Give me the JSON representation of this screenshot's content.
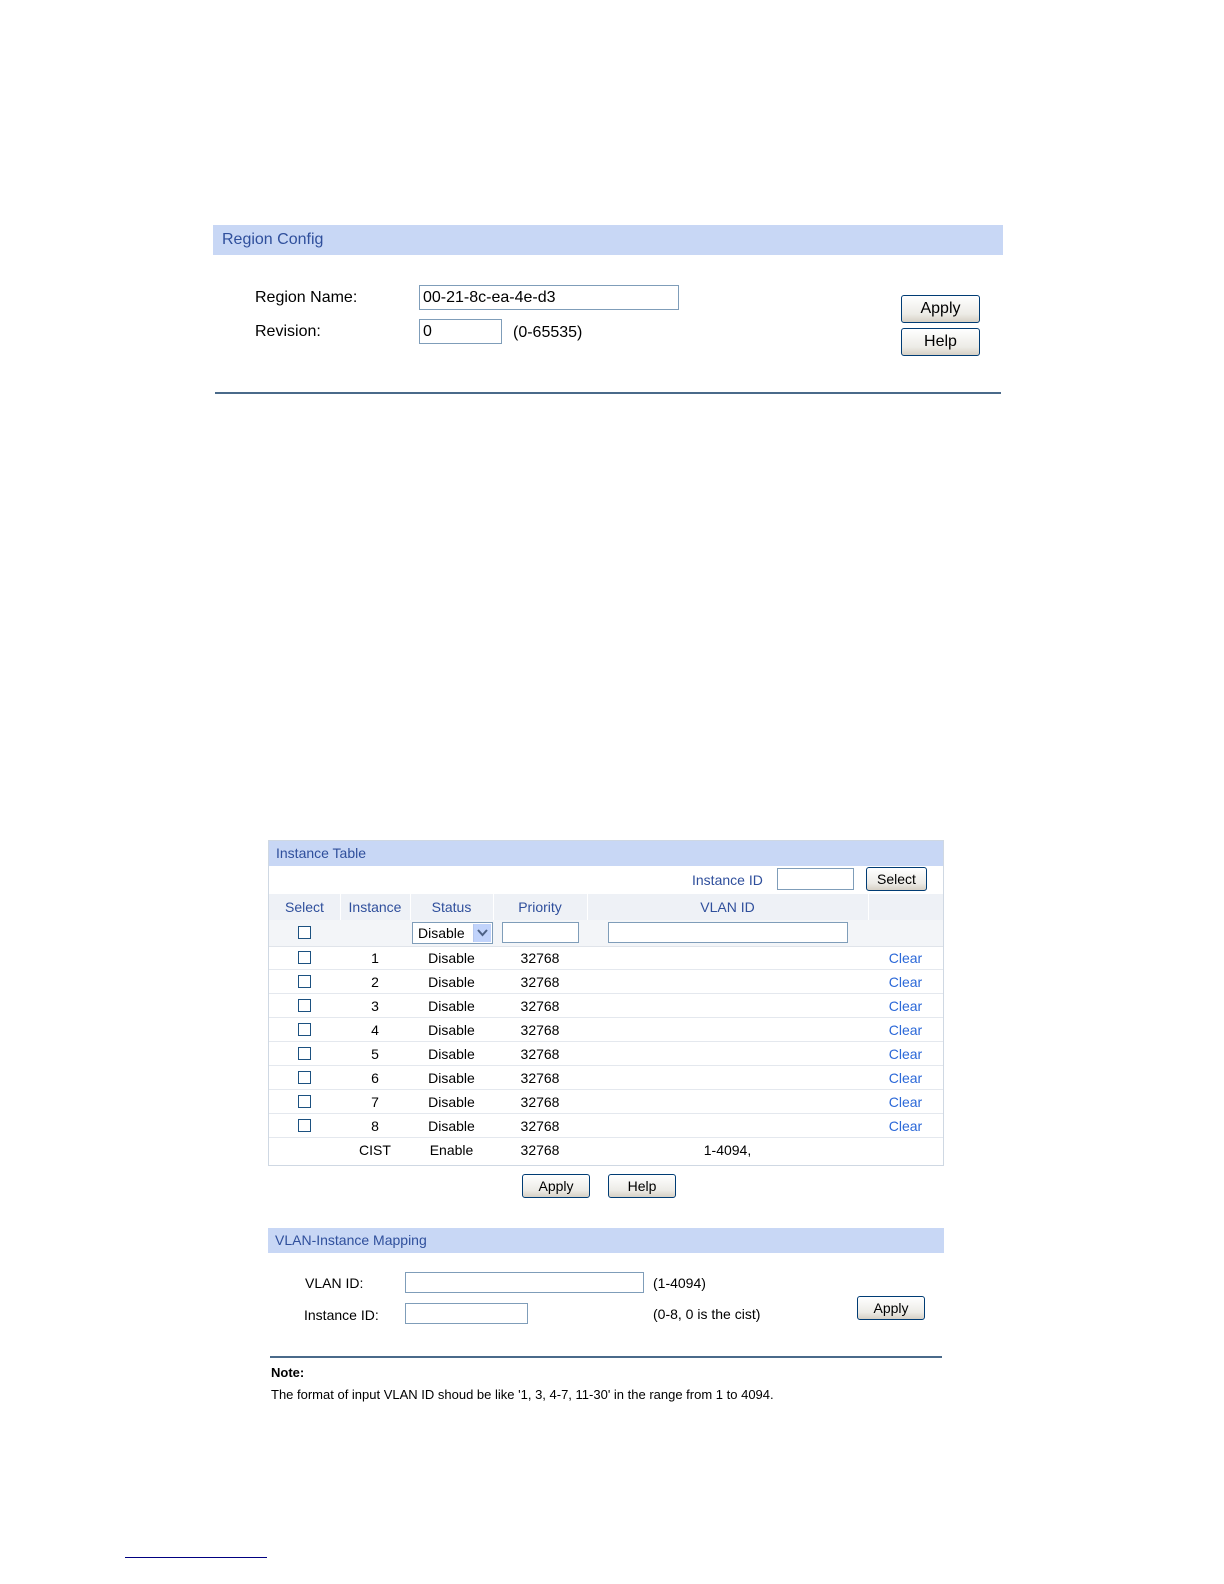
{
  "region_config": {
    "title": "Region Config",
    "region_name_label": "Region Name:",
    "region_name_value": "00-21-8c-ea-4e-d3",
    "revision_label": "Revision:",
    "revision_value": "0",
    "revision_hint": "(0-65535)",
    "apply_label": "Apply",
    "help_label": "Help"
  },
  "instance_table": {
    "title": "Instance Table",
    "instance_id_label": "Instance ID",
    "instance_id_value": "",
    "select_button_label": "Select",
    "columns": [
      "Select",
      "Instance",
      "Status",
      "Priority",
      "VLAN ID"
    ],
    "filter_status_value": "Disable",
    "filter_priority_value": "",
    "filter_vlan_value": "",
    "rows": [
      {
        "instance": "1",
        "status": "Disable",
        "priority": "32768",
        "vlan": "",
        "action": "Clear"
      },
      {
        "instance": "2",
        "status": "Disable",
        "priority": "32768",
        "vlan": "",
        "action": "Clear"
      },
      {
        "instance": "3",
        "status": "Disable",
        "priority": "32768",
        "vlan": "",
        "action": "Clear"
      },
      {
        "instance": "4",
        "status": "Disable",
        "priority": "32768",
        "vlan": "",
        "action": "Clear"
      },
      {
        "instance": "5",
        "status": "Disable",
        "priority": "32768",
        "vlan": "",
        "action": "Clear"
      },
      {
        "instance": "6",
        "status": "Disable",
        "priority": "32768",
        "vlan": "",
        "action": "Clear"
      },
      {
        "instance": "7",
        "status": "Disable",
        "priority": "32768",
        "vlan": "",
        "action": "Clear"
      },
      {
        "instance": "8",
        "status": "Disable",
        "priority": "32768",
        "vlan": "",
        "action": "Clear"
      }
    ],
    "cist_row": {
      "instance": "CIST",
      "status": "Enable",
      "priority": "32768",
      "vlan": "1-4094,"
    },
    "apply_label": "Apply",
    "help_label": "Help"
  },
  "vlan_mapping": {
    "title": "VLAN-Instance Mapping",
    "vlan_id_label": "VLAN ID:",
    "vlan_id_value": "",
    "vlan_id_hint": "(1-4094)",
    "instance_id_label": "Instance ID:",
    "instance_id_value": "",
    "instance_id_hint": "(0-8, 0 is the cist)",
    "apply_label": "Apply"
  },
  "note": {
    "title": "Note:",
    "text": "The format of input VLAN ID shoud be like '1, 3, 4-7, 11-30' in the range from 1 to 4094."
  }
}
